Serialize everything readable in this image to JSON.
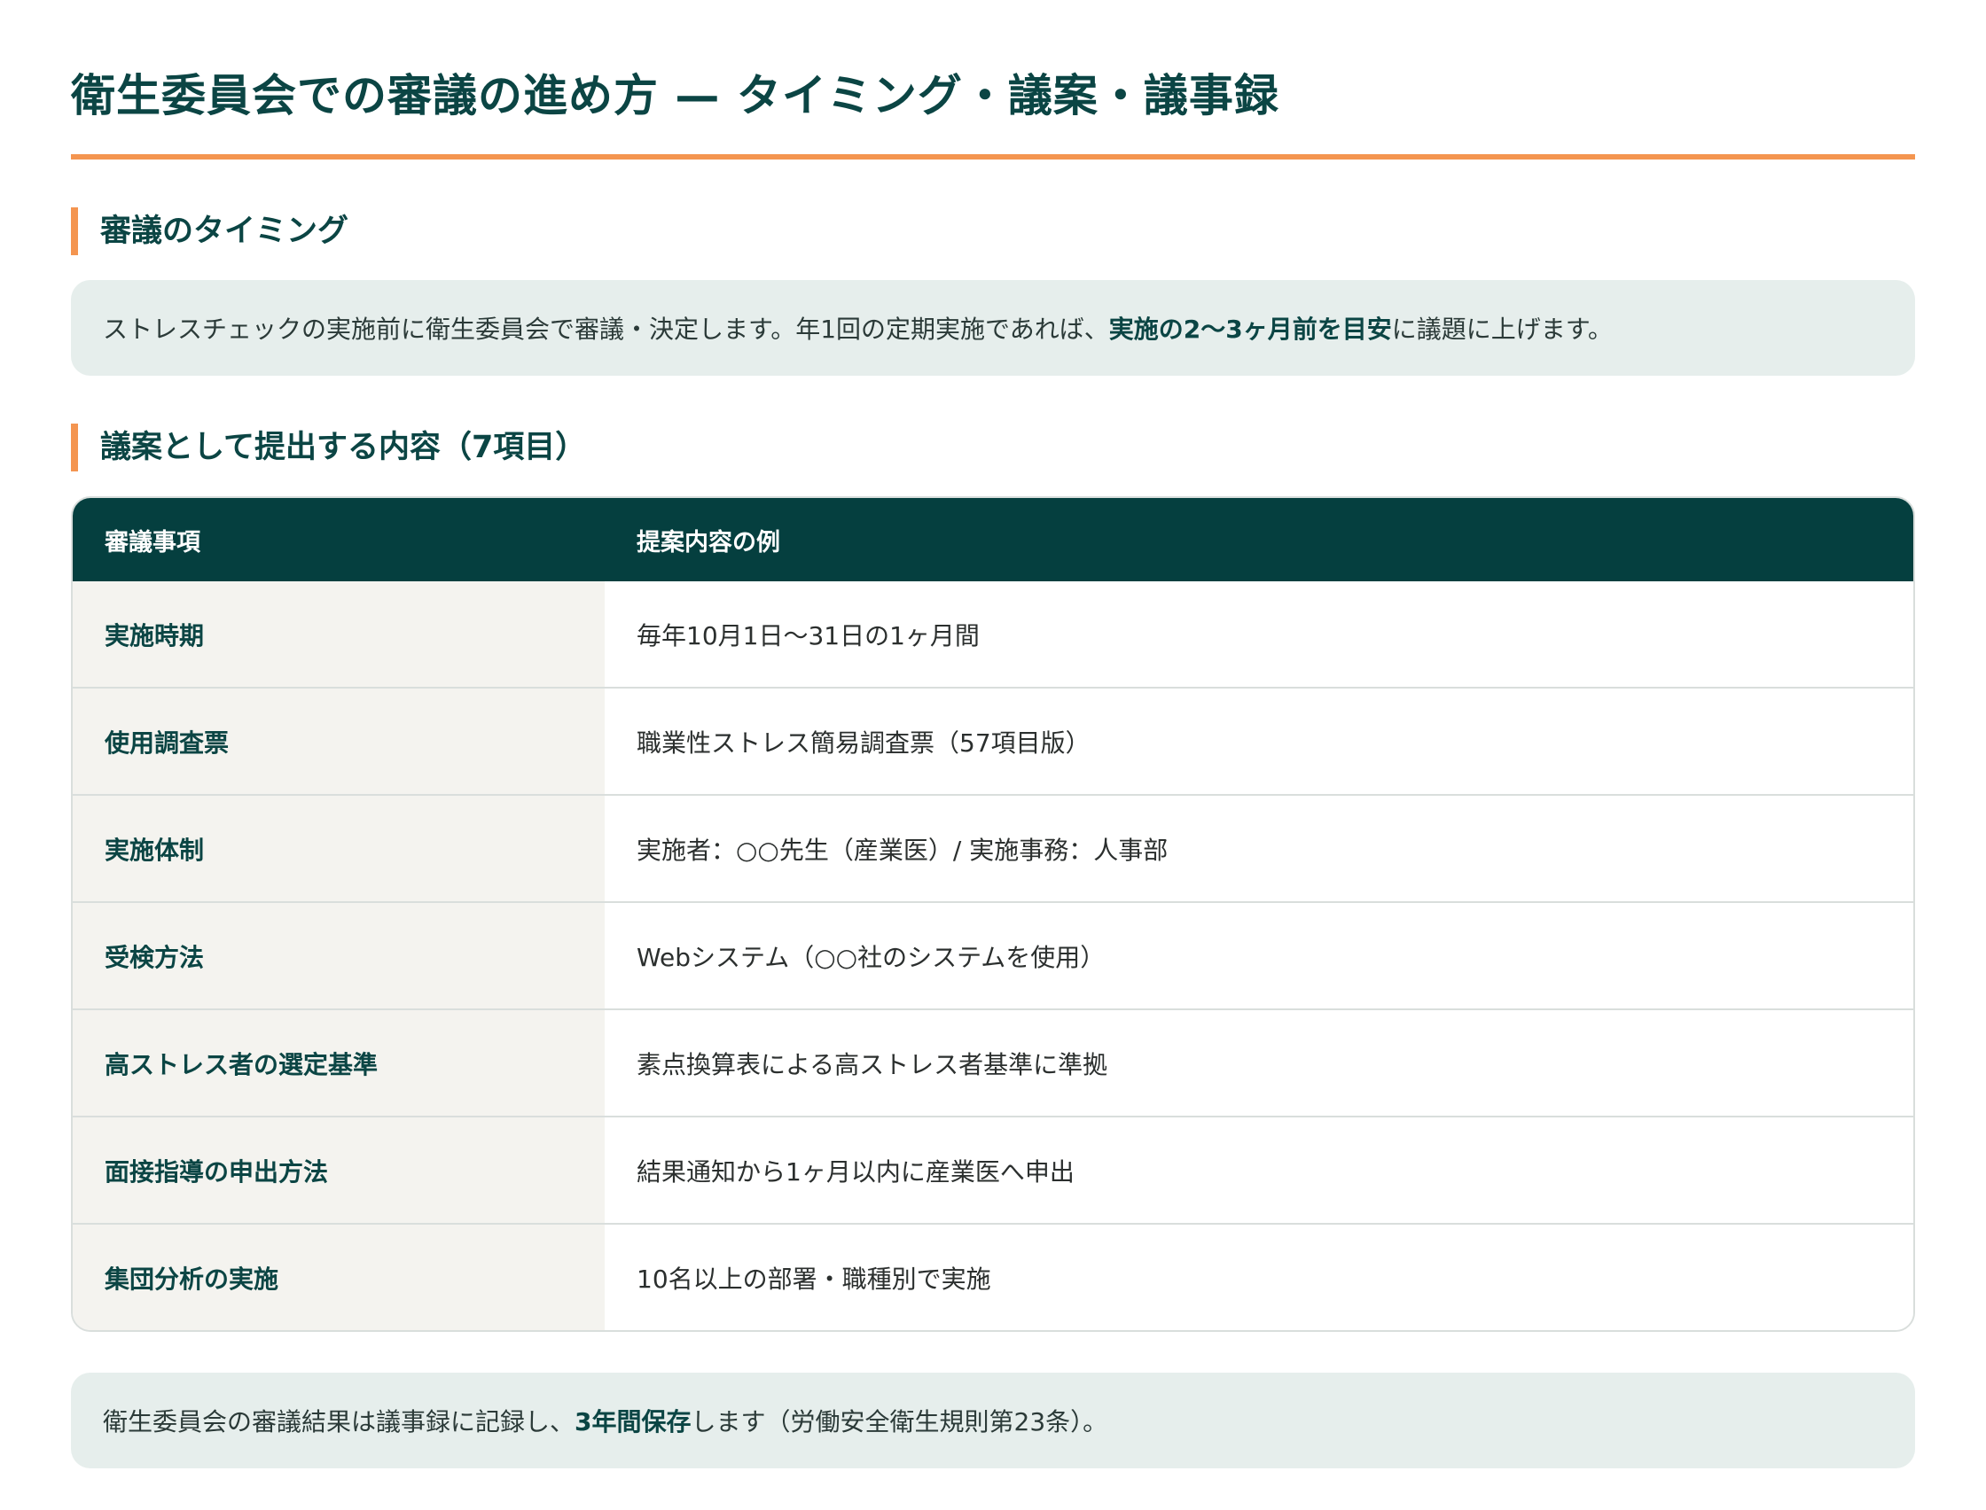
{
  "title": "衛生委員会での審議の進め方 — タイミング・議案・議事録",
  "colors": {
    "accent": "#f49550",
    "heading": "#0b4544",
    "table_header_bg": "#053f3f",
    "info_bg": "#e6eeec",
    "item_cell_bg": "#f4f3ef"
  },
  "timing": {
    "heading": "審議のタイミング",
    "text_before": "ストレスチェックの実施前に衛生委員会で審議・決定します。年1回の定期実施であれば、",
    "text_bold": "実施の2〜3ヶ月前を目安",
    "text_after": "に議題に上げます。"
  },
  "agenda": {
    "heading": "議案として提出する内容（7項目）",
    "columns": [
      "審議事項",
      "提案内容の例"
    ],
    "rows": [
      {
        "item": "実施時期",
        "example": "毎年10月1日〜31日の1ヶ月間"
      },
      {
        "item": "使用調査票",
        "example": "職業性ストレス簡易調査票（57項目版）"
      },
      {
        "item": "実施体制",
        "example": "実施者：○○先生（産業医）/ 実施事務：人事部"
      },
      {
        "item": "受検方法",
        "example": "Webシステム（○○社のシステムを使用）"
      },
      {
        "item": "高ストレス者の選定基準",
        "example": "素点換算表による高ストレス者基準に準拠"
      },
      {
        "item": "面接指導の申出方法",
        "example": "結果通知から1ヶ月以内に産業医へ申出"
      },
      {
        "item": "集団分析の実施",
        "example": "10名以上の部署・職種別で実施"
      }
    ]
  },
  "minutes": {
    "text_before": "衛生委員会の審議結果は議事録に記録し、",
    "text_bold": "3年間保存",
    "text_after": "します（労働安全衛生規則第23条）。"
  }
}
